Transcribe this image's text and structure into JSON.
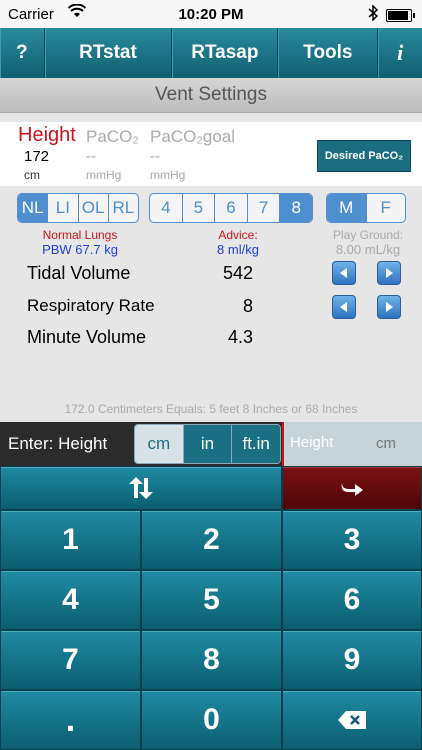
{
  "status": {
    "carrier": "Carrier",
    "time": "10:20 PM"
  },
  "nav": {
    "help": "?",
    "rtstat": "RTstat",
    "rtasap": "RTasap",
    "tools": "Tools",
    "info": "i"
  },
  "title": "Vent Settings",
  "measure": {
    "height_label": "Height",
    "height_value": "172",
    "height_unit": "cm",
    "paco2_label": "PaCO₂",
    "paco2_value": "--",
    "paco2_unit": "mmHg",
    "goal_label": "PaCO₂goal",
    "goal_value": "--",
    "goal_unit": "mmHg",
    "desired_button": "Desired PaCO₂"
  },
  "lung_options": [
    "NL",
    "LI",
    "OL",
    "RL"
  ],
  "lung_selected": "NL",
  "ml_options": [
    "4",
    "5",
    "6",
    "7",
    "8"
  ],
  "ml_selected": "8",
  "sex_options": [
    "M",
    "F"
  ],
  "sex_selected": "M",
  "info": {
    "lungs_title": "Normal Lungs",
    "pbw": "PBW 67.7 kg",
    "advice_title": "Advice:",
    "advice_value": "8 ml/kg",
    "play_title": "Play Ground:",
    "play_value": "8.00 mL/kg"
  },
  "rows": {
    "tv_label": "Tidal Volume",
    "tv_value": "542",
    "rr_label": "Respiratory Rate",
    "rr_value": "8",
    "mv_label": "Minute Volume",
    "mv_value": "4.3"
  },
  "conversion": "172.0 Centimeters Equals: 5 feet  8 Inches or 68 Inches",
  "input": {
    "enter_label": "Enter: Height",
    "units": [
      "cm",
      "in",
      "ft.in"
    ],
    "unit_selected": "cm",
    "placeholder": "Height",
    "unit_display": "cm"
  },
  "keypad": {
    "k1": "1",
    "k2": "2",
    "k3": "3",
    "k4": "4",
    "k5": "5",
    "k6": "6",
    "k7": "7",
    "k8": "8",
    "k9": "9",
    "k0": "0",
    "kdot": "."
  },
  "colors": {
    "teal": "#1a6f83",
    "red_label": "#c8151a",
    "blue": "#4f8fcf",
    "enter_red": "#6a0c0e"
  }
}
